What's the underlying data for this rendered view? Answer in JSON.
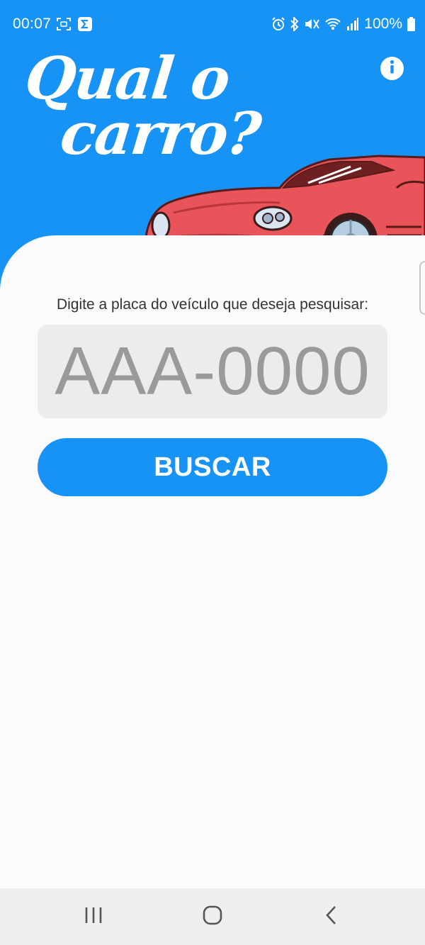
{
  "status_bar": {
    "time": "00:07",
    "battery": "100%",
    "icons": [
      "screenshot-icon",
      "sigma-app-icon",
      "alarm-icon",
      "bluetooth-icon",
      "mute-icon",
      "wifi-icon",
      "signal-icon",
      "battery-icon"
    ]
  },
  "header": {
    "logo_line1": "Qual o",
    "logo_line2": "carro?",
    "info_icon": "info-icon"
  },
  "colors": {
    "brand_blue": "#1793f5",
    "car_red": "#e8545a",
    "field_bg": "#ececee",
    "background": "#fbfafd"
  },
  "search": {
    "prompt": "Digite a placa do veículo que deseja pesquisar:",
    "placeholder": "AAA-0000",
    "value": "",
    "button_label": "BUSCAR"
  },
  "nav_bar": {
    "buttons": [
      "recent-apps-icon",
      "home-icon",
      "back-icon"
    ]
  }
}
